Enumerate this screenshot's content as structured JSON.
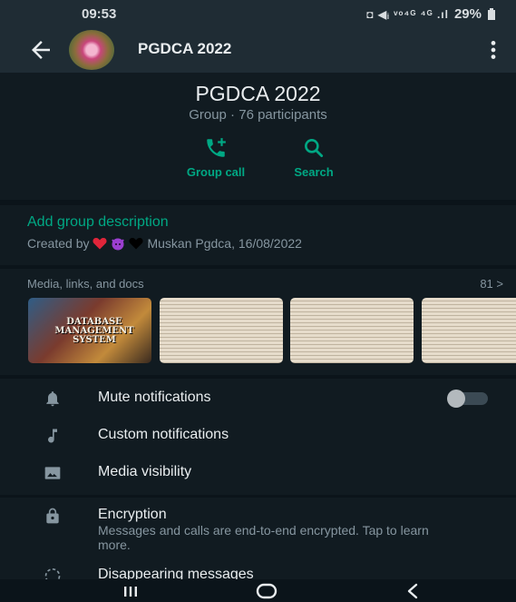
{
  "status_bar": {
    "time": "09:53",
    "icons_text": "◘ ◀ᵢ ᵛᵒ⁴ᴳ ⁴ᴳ .ıl",
    "battery": "29%"
  },
  "top_bar": {
    "title": "PGDCA 2022"
  },
  "group": {
    "name": "PGDCA 2022",
    "subtitle": "Group · 76 participants",
    "actions": [
      {
        "label": "Group call"
      },
      {
        "label": "Search"
      }
    ]
  },
  "description": {
    "add_label": "Add group description",
    "created_prefix": "Created by",
    "created_suffix": "Muskan Pgdca, 16/08/2022"
  },
  "media": {
    "title": "Media, links, and docs",
    "count": "81 >",
    "book_title": "DATABASE MANAGEMENT SYSTEM"
  },
  "settings": {
    "mute": "Mute notifications",
    "custom": "Custom notifications",
    "visibility": "Media visibility"
  },
  "encryption": {
    "title": "Encryption",
    "desc": "Messages and calls are end-to-end encrypted. Tap to learn more.",
    "disappearing": "Disappearing messages"
  },
  "colors": {
    "accent": "#00a884",
    "background": "#0b141a",
    "panel": "#111b21",
    "topbar": "#1f2c34"
  },
  "icons": [
    "back-arrow-icon",
    "more-vert-icon",
    "add-call-icon",
    "search-icon",
    "bell-icon",
    "music-note-icon",
    "image-icon",
    "lock-icon",
    "timer-icon",
    "recents-icon",
    "home-icon",
    "back-icon"
  ]
}
